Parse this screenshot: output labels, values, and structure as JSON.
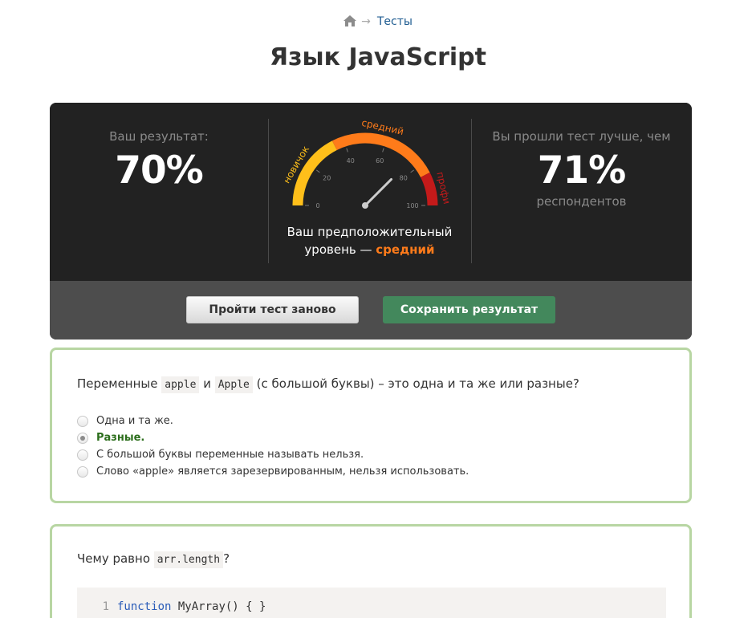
{
  "breadcrumbs": {
    "home_icon": "home-icon",
    "arrow": "→",
    "link": "Тесты"
  },
  "title": "Язык JavaScript",
  "result": {
    "label": "Ваш результат:",
    "value": "70%",
    "better_label": "Вы прошли тест лучше, чем",
    "better_value": "71%",
    "better_sub": "респондентов",
    "level_prefix": "Ваш предположительный уровень —",
    "level_value": "средний"
  },
  "gauge": {
    "ticks": [
      "0",
      "20",
      "40",
      "60",
      "80",
      "100"
    ],
    "zones": [
      "новичок",
      "средний",
      "профи"
    ],
    "needle_value": 75,
    "colors": {
      "novice": "#ffbf1a",
      "mid": "#ff7b1a",
      "pro": "#c41a1a"
    }
  },
  "actions": {
    "retry": "Пройти тест заново",
    "save": "Сохранить результат"
  },
  "questions": [
    {
      "pre": "Переменные",
      "code1": "apple",
      "mid": "и",
      "code2": "Apple",
      "post": "(с большой буквы) – это одна и та же или разные?",
      "options": [
        {
          "label": "Одна и та же.",
          "checked": false,
          "correct": false
        },
        {
          "label": "Разные.",
          "checked": true,
          "correct": true
        },
        {
          "label": "С большой буквы переменные называть нельзя.",
          "checked": false,
          "correct": false
        },
        {
          "label": "Слово «apple» является зарезервированным, нельзя использовать.",
          "checked": false,
          "correct": false
        }
      ]
    },
    {
      "pre": "Чему равно",
      "code": "arr.length",
      "post": "?",
      "code_lines": [
        {
          "num": "1",
          "kw": "function",
          "rest": "MyArray() { }"
        }
      ]
    }
  ],
  "colors": {
    "card_border": "#b8d6a3",
    "save_button": "#43885c",
    "accent_level": "#ff7b1a",
    "correct": "#2c6e1c"
  }
}
